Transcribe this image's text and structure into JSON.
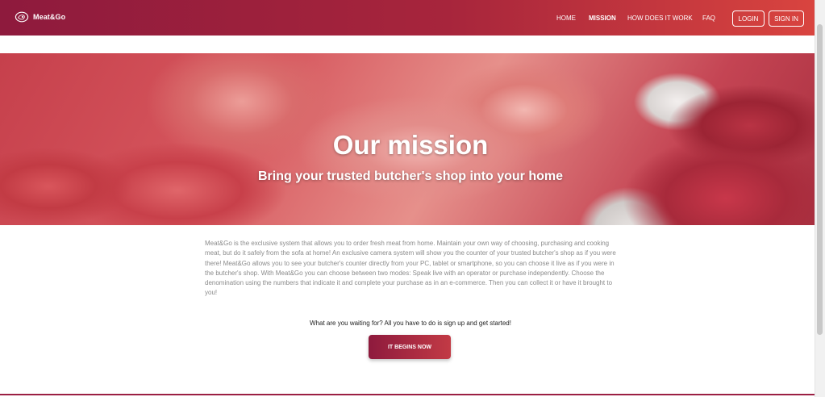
{
  "nav": {
    "brand": "Meat&Go",
    "brand_icon": "logo-icon",
    "links": [
      "HOME",
      "MISSION",
      "HOW DOES IT WORK",
      "FAQ"
    ],
    "active": "MISSION",
    "login": "LOGIN",
    "signin": "SIGN IN"
  },
  "hero": {
    "title": "Our mission",
    "subtitle": "Bring your trusted butcher's shop into your home"
  },
  "main": {
    "description": "Meat&Go is the exclusive system that allows you to order fresh meat from home. Maintain your own way of choosing, purchasing and cooking meat, but do it safely from the sofa at home! An exclusive camera system will show you the counter of your trusted butcher's shop as if you were there! Meat&Go allows you to see your butcher's counter directly from your PC, tablet or smartphone, so you can choose it live as if you were in the butcher's shop. With Meat&Go you can choose between two modes: Speak live with an operator or purchase independently. Choose the denomination using the numbers that indicate it and complete your purchase as in an e-commerce. Then you can collect it or have it brought to you!",
    "cta_text": "What are you waiting for? All you have to do is sign up and get started!",
    "cta_button": "IT BEGINS NOW"
  },
  "colors": {
    "brand_dark": "#8e1a3d",
    "brand_light": "#d9443f"
  }
}
